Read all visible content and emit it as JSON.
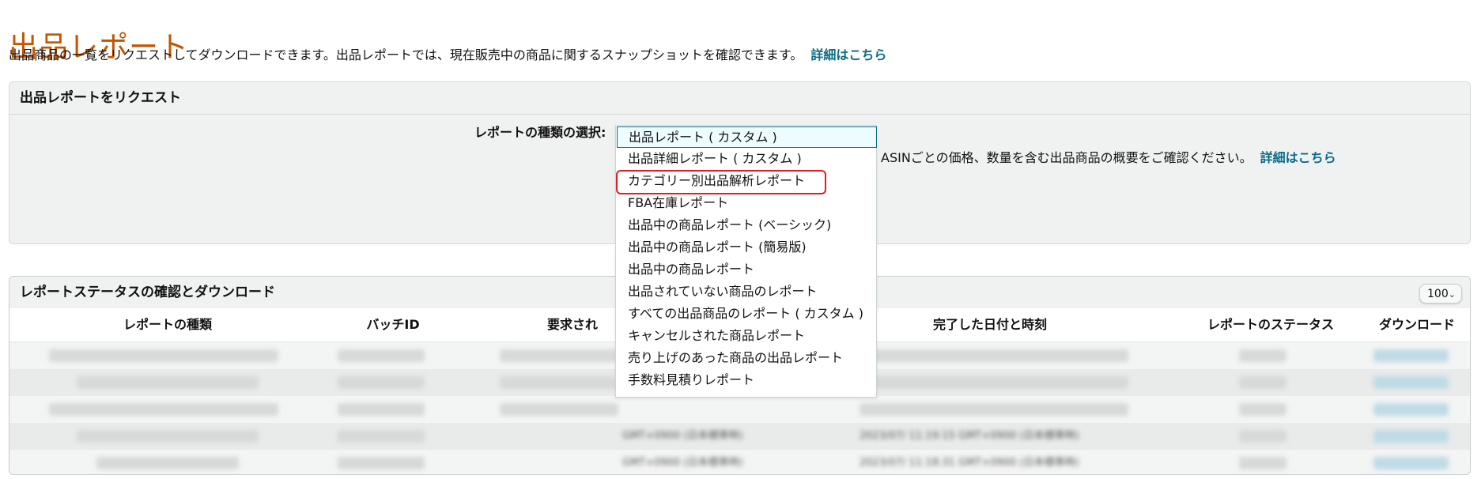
{
  "page": {
    "title": "出品レポート",
    "description": "出品商品の一覧をリクエストしてダウンロードできます。出品レポートでは、現在販売中の商品に関するスナップショットを確認できます。",
    "details_link": "詳細はこちら"
  },
  "request_panel": {
    "header": "出品レポートをリクエスト",
    "select_label": "レポートの種類の選択:",
    "help_text": "ASINごとの価格、数量を含む出品商品の概要をご確認ください。",
    "help_link": "詳細はこちら"
  },
  "dropdown": {
    "selected": "出品レポート ( カスタム )",
    "options": [
      "出品レポート ( カスタム )",
      "出品詳細レポート ( カスタム )",
      "カテゴリー別出品解析レポート",
      "FBA在庫レポート",
      "出品中の商品レポート (ベーシック)",
      "出品中の商品レポート (簡易版)",
      "出品中の商品レポート",
      "出品されていない商品のレポート",
      "すべての出品商品のレポート ( カスタム )",
      "キャンセルされた商品レポート",
      "売り上げのあった商品の出品レポート",
      "手数料見積りレポート"
    ],
    "highlighted": "カテゴリー別出品解析レポート"
  },
  "status_panel": {
    "header": "レポートステータスの確認とダウンロード",
    "per_page": "100",
    "columns": {
      "type": "レポートの種類",
      "batch": "バッチID",
      "requested": "要求され",
      "completed": "完了した日付と時刻",
      "status": "レポートのステータス",
      "download": "ダウンロード"
    },
    "visible_cells": {
      "r4_req": "GMT+0900 (日本標準時)",
      "r4_done": "2023/07/ 11:19:15 GMT+0900 (日本標準時)",
      "r5_req": "GMT+0900 (日本標準時)",
      "r5_done": "2023/07/ 11:18:31 GMT+0900 (日本標準時)"
    }
  },
  "colors": {
    "title": "#c45500",
    "link": "#0a6b86",
    "panel_bg": "#f0f2f2",
    "highlight": "#e31b23"
  }
}
